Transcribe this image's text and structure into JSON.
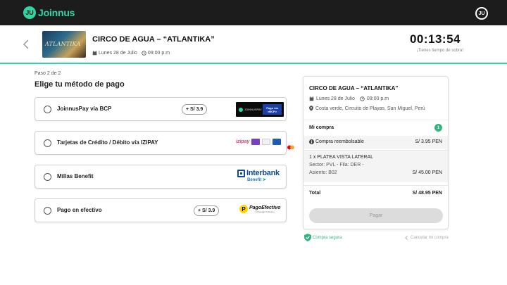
{
  "app": {
    "name": "Joinnus",
    "user_initials": "JU"
  },
  "event": {
    "title": "CIRCO DE AGUA – “ATLANTIKA”",
    "thumb_text": "ATLANTIKA",
    "date": "Lunes 28 de Julio",
    "time": "09:00 p.m",
    "venue": "Costa verde, Circuito de Playas, San Miguel, Perú"
  },
  "timer": {
    "value": "00:13:54",
    "caption": "¡Tienes tiempo de sobra!"
  },
  "checkout": {
    "step": "Paso 2 de 2",
    "title": "Elige tu método de pago",
    "methods": [
      {
        "label": "JoinnusPay vía BCP",
        "fee": "+ S/ 3.9",
        "logo_text": "JOINNUSPAY",
        "logo_sub": "Pago vía",
        "logo_brand": ">BCP>"
      },
      {
        "label": "Tarjetas de Crédito / Débito vía IZIPAY",
        "logo_text": "izipay"
      },
      {
        "label": "Millas Benefit",
        "logo_text": "Interbank",
        "logo_sub": "Benefit"
      },
      {
        "label": "Pago en efectivo",
        "fee": "+ S/ 3.9",
        "logo_text": "PagoEfectivo",
        "logo_sub": "A Paysafe Company"
      }
    ]
  },
  "summary": {
    "title": "CIRCO DE AGUA – “ATLANTIKA”",
    "purchase_label": "Mi compra",
    "purchase_count": "1",
    "refund_label": "Compra reembolsable",
    "refund_price": "S/ 3.95 PEN",
    "item_title": "1 x PLATEA VISTA LATERAL",
    "item_sector": "Sector: PVL - Fila: DER -",
    "item_seat": "Asiento: B02",
    "item_price": "S/ 45.00 PEN",
    "total_label": "Total",
    "total_value": "S/ 48.95 PEN",
    "pay_label": "Pagar"
  },
  "footer": {
    "secure_label": "Compra segura",
    "cancel_label": "Cancelar mi compra"
  },
  "colors": {
    "brand": "#2fd6a4",
    "nav": "#1c1c1c",
    "success": "#36b37e",
    "interbank": "#0e4c96",
    "izipay": "#e63e6d"
  }
}
